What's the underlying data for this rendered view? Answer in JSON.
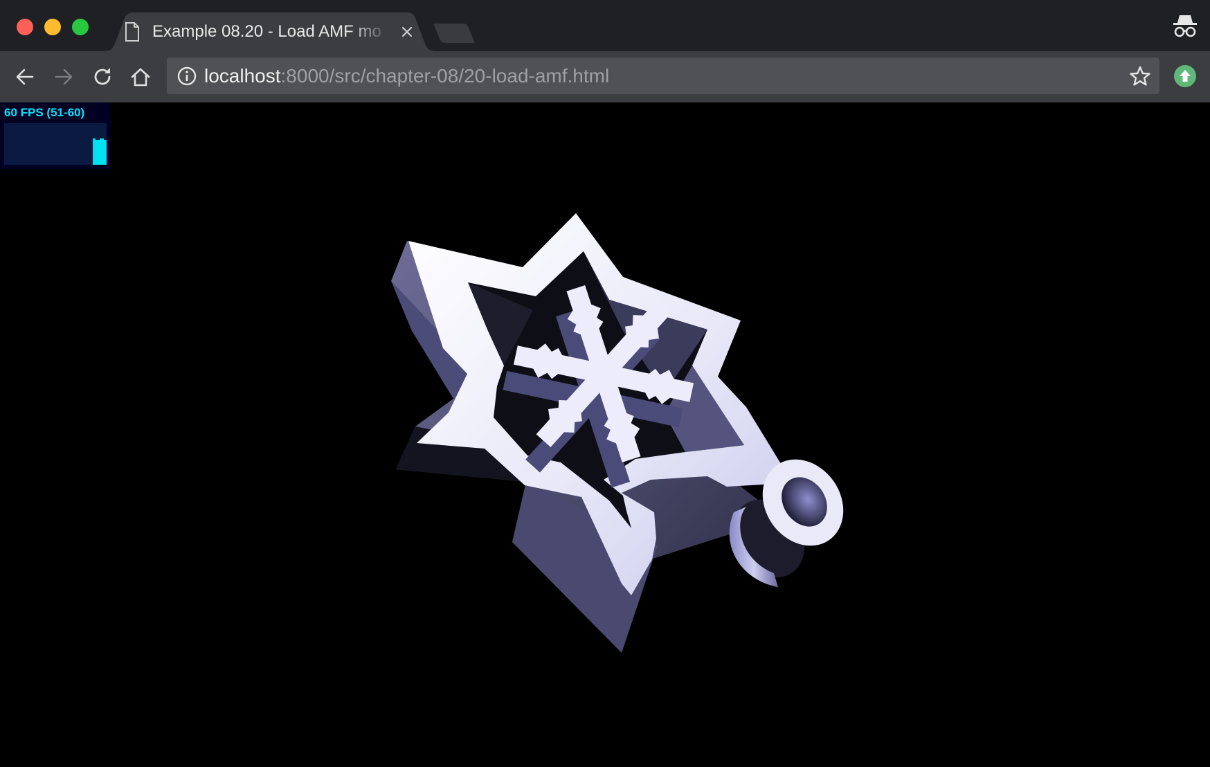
{
  "browser": {
    "tab_title": "Example 08.20 - Load AMF mo",
    "url_host": "localhost",
    "url_rest": ":8000/src/chapter-08/20-load-amf.html"
  },
  "icons": {
    "page": "page-icon",
    "close": "close-icon",
    "incognito": "incognito-icon",
    "back": "back-arrow-icon",
    "forward": "forward-arrow-icon",
    "reload": "reload-icon",
    "home": "home-icon",
    "info": "info-icon",
    "bookmark": "star-icon",
    "extension": "upload-arrow-icon"
  },
  "colors": {
    "titlebar": "#1f2023",
    "toolbar": "#3c3d40",
    "omnibox": "#505154",
    "fps_text": "#00e5ff",
    "model": "#e4e4f6"
  },
  "stats": {
    "fps_label": "60 FPS (51-60)"
  }
}
